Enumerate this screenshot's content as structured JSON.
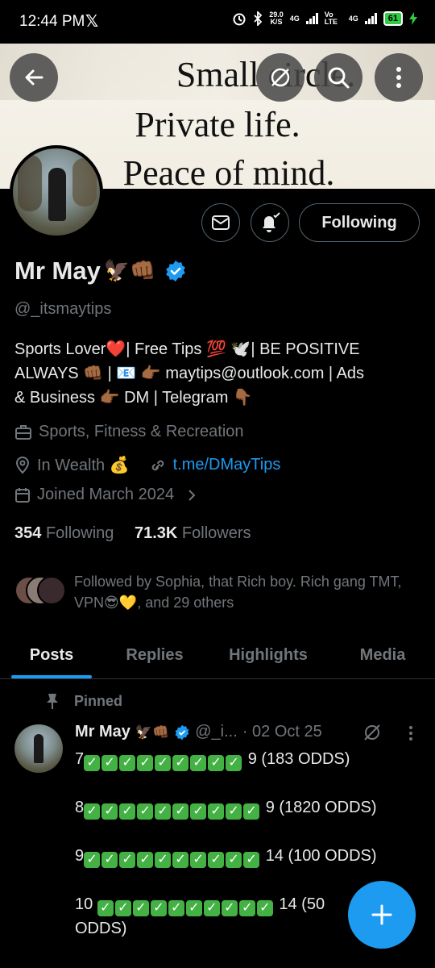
{
  "status_bar": {
    "time": "12:44 PM",
    "x_logo": "𝕏",
    "speed_value": "29.0",
    "speed_unit": "K/S",
    "net1": "4G",
    "volte": "Vo LTE",
    "net2": "4G",
    "battery": "61"
  },
  "banner": {
    "line1": "Small circle.",
    "line2": "Private life.",
    "line3": "Peace of mind."
  },
  "profile": {
    "name": "Mr May",
    "name_emojis": "🦅👊🏾",
    "handle": "@_itsmaytips",
    "following_button": "Following",
    "bio_line1": "Sports Lover❤️| Free Tips 💯 🕊️| BE POSITIVE",
    "bio_line2": "ALWAYS 👊🏾 | 📧 👉🏾 maytips@outlook.com | Ads",
    "bio_line3": "& Business 👉🏾 DM | Telegram 👇🏾",
    "category": "Sports, Fitness & Recreation",
    "location": "In Wealth 💰",
    "link": "t.me/DMayTips",
    "joined": "Joined March 2024",
    "following_count": "354",
    "following_label": "Following",
    "followers_count": "71.3K",
    "followers_label": "Followers",
    "followed_by": "Followed by Sophia, that Rich boy. Rich gang TMT, VPN😎💛, and 29 others"
  },
  "tabs": [
    {
      "label": "Posts"
    },
    {
      "label": "Replies"
    },
    {
      "label": "Highlights"
    },
    {
      "label": "Media"
    }
  ],
  "post": {
    "pinned_label": "Pinned",
    "author": "Mr May",
    "author_emojis": "🦅👊🏾",
    "handle": "@_i...",
    "date": "· 02 Oct 25",
    "lines": [
      {
        "prefix": "7",
        "checks": 9,
        "suffix": "9 (183 ODDS)"
      },
      {
        "prefix": "8",
        "checks": 10,
        "suffix": "9 (1820 ODDS)"
      },
      {
        "prefix": "9",
        "checks": 10,
        "suffix": "14 (100 ODDS)"
      },
      {
        "prefix": "10 ",
        "checks": 10,
        "suffix": "14 (50"
      }
    ],
    "last_line_wrap": "ODDS)"
  },
  "colors": {
    "accent": "#1d9bf0",
    "muted": "#71767b",
    "text": "#e7e9ea",
    "border": "#2f3336"
  }
}
